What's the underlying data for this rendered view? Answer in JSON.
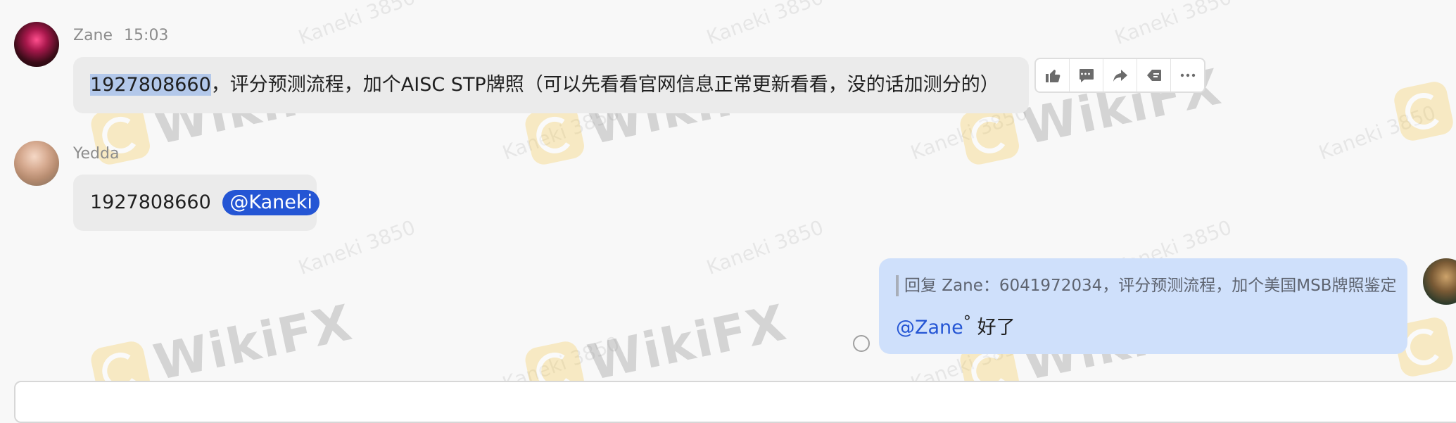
{
  "watermark": {
    "user_text": "Kaneki 3850",
    "brand_text": "WikiFX"
  },
  "messages": [
    {
      "sender": "Zane",
      "time": "15:03",
      "selected_text": "1927808660",
      "text": "，评分预测流程，加个AISC STP牌照（可以先看看官网信息正常更新看看，没的话加测分的）"
    },
    {
      "sender": "Yedda",
      "text": "1927808660 ",
      "mention": "@Kaneki"
    },
    {
      "self": true,
      "quote": "回复 Zane：6041972034，评分预测流程，加个美国MSB牌照鉴定",
      "mention": "@Zane",
      "superscript": "°",
      "text": " 好了"
    }
  ],
  "hover_actions": [
    {
      "icon": "thumbs-up-icon"
    },
    {
      "icon": "comment-icon"
    },
    {
      "icon": "forward-icon"
    },
    {
      "icon": "back-icon"
    },
    {
      "icon": "more-icon"
    }
  ]
}
